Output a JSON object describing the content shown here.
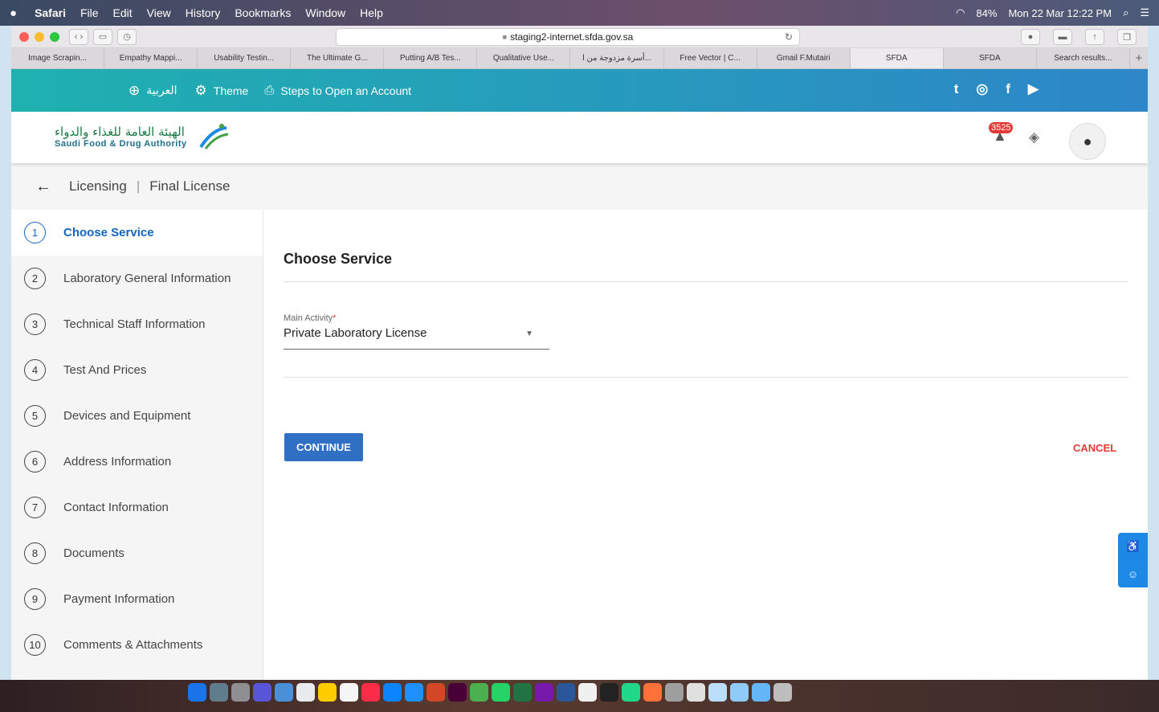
{
  "menubar": {
    "apple": "",
    "items": [
      "Safari",
      "File",
      "Edit",
      "View",
      "History",
      "Bookmarks",
      "Window",
      "Help"
    ],
    "battery": "84%",
    "datetime": "Mon 22 Mar  12:22 PM"
  },
  "browser": {
    "url": "staging2-internet.sfda.gov.sa",
    "tabs": [
      "Image Scrapin...",
      "Empathy Mappi...",
      "Usability Testin...",
      "The Ultimate G...",
      "Putting A/B Tes...",
      "Qualitative Use...",
      "أسرة مزدوجة من ا...",
      "Free Vector | C...",
      "Gmail F.Mutairi",
      "SFDA",
      "SFDA",
      "Search results..."
    ],
    "active_tab_index": 9
  },
  "sitebar": {
    "language": "العربية",
    "theme": "Theme",
    "steps_link": "Steps to Open an Account"
  },
  "header": {
    "logo_ar": "الهيئة العامة للغذاء والدواء",
    "logo_en": "Saudi Food & Drug Authority",
    "notification_count": "3525"
  },
  "breadcrumb": {
    "section": "Licensing",
    "page": "Final License"
  },
  "steps": [
    {
      "num": "1",
      "label": "Choose Service"
    },
    {
      "num": "2",
      "label": "Laboratory General Information"
    },
    {
      "num": "3",
      "label": "Technical Staff Information"
    },
    {
      "num": "4",
      "label": "Test And Prices"
    },
    {
      "num": "5",
      "label": "Devices and Equipment"
    },
    {
      "num": "6",
      "label": "Address Information"
    },
    {
      "num": "7",
      "label": "Contact Information"
    },
    {
      "num": "8",
      "label": "Documents"
    },
    {
      "num": "9",
      "label": "Payment Information"
    },
    {
      "num": "10",
      "label": "Comments & Attachments"
    }
  ],
  "form": {
    "title": "Choose Service",
    "main_activity_label": "Main Activity",
    "required_mark": "*",
    "main_activity_value": "Private Laboratory License",
    "continue_label": "CONTINUE",
    "cancel_label": "CANCEL"
  },
  "colors": {
    "accent": "#1565c0",
    "button": "#2f6fc4",
    "cancel": "#e53935",
    "sitebar_start": "#1fb1b0",
    "sitebar_end": "#2d86c8"
  }
}
